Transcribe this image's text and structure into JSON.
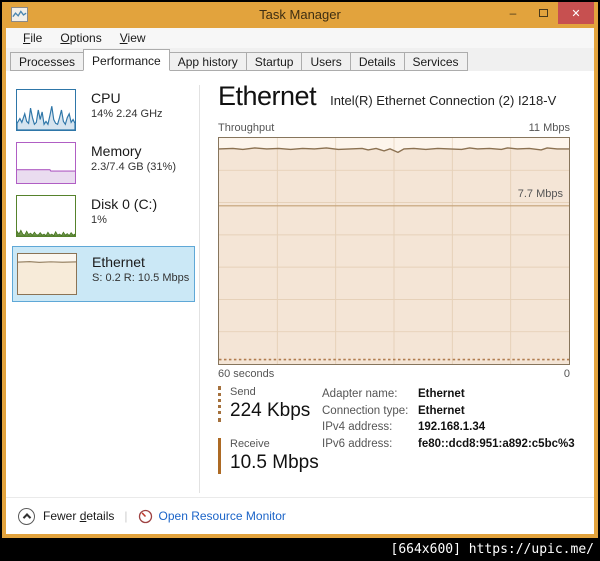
{
  "window": {
    "title": "Task Manager",
    "controls": {
      "minimize": "–",
      "close": "✕"
    }
  },
  "menu": {
    "items": [
      {
        "k": "F",
        "rest": "ile"
      },
      {
        "k": "O",
        "rest": "ptions"
      },
      {
        "k": "V",
        "rest": "iew"
      }
    ]
  },
  "tabs": [
    "Processes",
    "Performance",
    "App history",
    "Startup",
    "Users",
    "Details",
    "Services"
  ],
  "active_tab": "Performance",
  "sidebar": {
    "items": [
      {
        "name": "CPU",
        "detail": "14%  2.24 GHz",
        "selected": false
      },
      {
        "name": "Memory",
        "detail": "2.3/7.4 GB (31%)",
        "selected": false
      },
      {
        "name": "Disk 0 (C:)",
        "detail": "1%",
        "selected": false
      },
      {
        "name": "Ethernet",
        "detail": "S: 0.2 R: 10.5 Mbps",
        "selected": true
      }
    ]
  },
  "main": {
    "title": "Ethernet",
    "subtitle": "Intel(R) Ethernet Connection (2) I218-V",
    "graph": {
      "top_left": "Throughput",
      "top_right": "11 Mbps",
      "inner_label": "7.7 Mbps",
      "bottom_left": "60 seconds",
      "bottom_right": "0"
    },
    "stats": {
      "send_label": "Send",
      "send_value": "224 Kbps",
      "receive_label": "Receive",
      "receive_value": "10.5 Mbps"
    },
    "details": [
      {
        "label": "Adapter name:",
        "value": "Ethernet"
      },
      {
        "label": "Connection type:",
        "value": "Ethernet"
      },
      {
        "label": "IPv4 address:",
        "value": "192.168.1.34"
      },
      {
        "label": "IPv6 address:",
        "value": "fe80::dcd8:951:a892:c5bc%3"
      }
    ]
  },
  "footer": {
    "fewer": {
      "pre": "Fewer ",
      "k": "d",
      "rest": "etails"
    },
    "separator": "|",
    "link": "Open Resource Monitor"
  },
  "watermark": {
    "text": "[664x600] https://upic.me/"
  },
  "colors": {
    "titlebar_gold": "#E2A33D",
    "close_red": "#C75050",
    "selection_fill": "#CBE8F6",
    "selection_border": "#5FA8D7",
    "link_blue": "#1B64C8",
    "cpu_blue": "#2E76A8",
    "memory_purple": "#B05EC4",
    "disk_green": "#56822C",
    "ethernet_brown": "#8B7355",
    "graph_bg": "#FDF5EC",
    "grid_line": "#ECDCC8"
  },
  "chart_data": {
    "type": "line",
    "title": "Throughput",
    "x_left_label": "60 seconds",
    "x_right_label": "0",
    "ylim_mbps": [
      0,
      11
    ],
    "y_axis_top_label": "11 Mbps",
    "reference_line_mbps": 7.7,
    "x_seconds_ago": [
      60,
      55,
      50,
      45,
      40,
      35,
      30,
      25,
      20,
      15,
      10,
      5,
      0
    ],
    "series": [
      {
        "name": "Receive",
        "style": "solid",
        "values_mbps": [
          10.4,
          10.5,
          10.4,
          10.5,
          10.5,
          10.4,
          10.2,
          10.5,
          10.4,
          10.5,
          10.4,
          10.3,
          10.5
        ]
      },
      {
        "name": "Send",
        "style": "dotted",
        "values_mbps": [
          0.2,
          0.2,
          0.2,
          0.2,
          0.2,
          0.2,
          0.2,
          0.2,
          0.2,
          0.2,
          0.2,
          0.2,
          0.2
        ]
      }
    ]
  }
}
